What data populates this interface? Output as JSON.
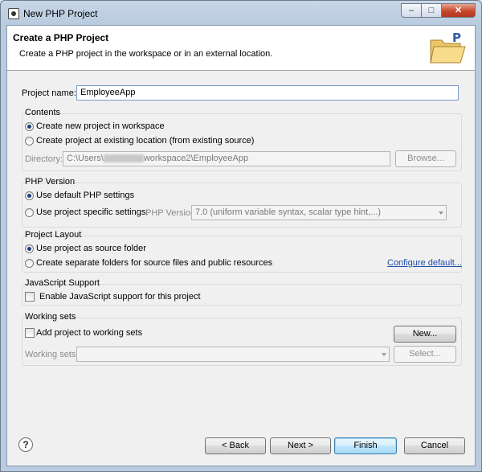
{
  "window": {
    "title": "New PHP Project",
    "controls": {
      "minimize": "–",
      "maximize": "□",
      "close": "✕"
    }
  },
  "header": {
    "title": "Create a PHP Project",
    "description": "Create a PHP project in the workspace or in an external location.",
    "icon": "php-folder-icon"
  },
  "project_name": {
    "label": "Project name:",
    "value": "EmployeeApp"
  },
  "contents": {
    "title": "Contents",
    "option_new": "Create new project in workspace",
    "option_existing": "Create project at existing location (from existing source)",
    "directory_label": "Directory:",
    "directory_prefix": "C:\\Users\\",
    "directory_suffix": "workspace2\\EmployeeApp",
    "browse": "Browse..."
  },
  "php_version": {
    "title": "PHP Version",
    "option_default": "Use default PHP settings",
    "option_specific": "Use project specific settings:",
    "version_label": "PHP Version:",
    "version_value": "7.0 (uniform variable syntax, scalar type hint,...)"
  },
  "project_layout": {
    "title": "Project Layout",
    "option_source": "Use project as source folder",
    "option_separate": "Create separate folders for source files and public resources",
    "configure_link": "Configure default..."
  },
  "javascript": {
    "title": "JavaScript Support",
    "enable_label": "Enable JavaScript support for this project"
  },
  "working_sets": {
    "title": "Working sets",
    "add_label": "Add project to working sets",
    "new_button": "New...",
    "sets_label": "Working sets:",
    "select_button": "Select..."
  },
  "footer": {
    "help": "?",
    "back": "< Back",
    "next": "Next >",
    "finish": "Finish",
    "cancel": "Cancel"
  }
}
